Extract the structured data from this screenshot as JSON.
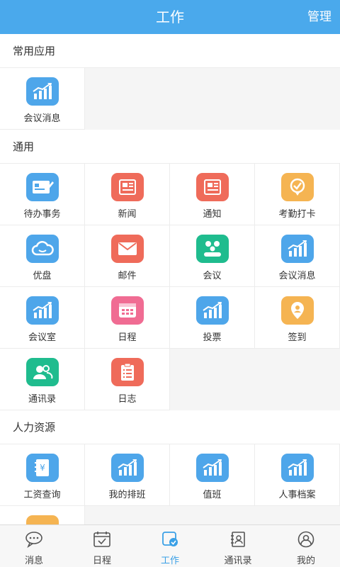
{
  "header": {
    "title": "工作",
    "manage": "管理"
  },
  "sections": [
    {
      "title": "常用应用",
      "items": [
        {
          "label": "会议消息",
          "icon": "bar-chart-icon",
          "color": "#4ea6ea"
        }
      ]
    },
    {
      "title": "通用",
      "items": [
        {
          "label": "待办事务",
          "icon": "todo-card-icon",
          "color": "#4ea6ea"
        },
        {
          "label": "新闻",
          "icon": "newspaper-icon",
          "color": "#ef6b5a"
        },
        {
          "label": "通知",
          "icon": "notice-icon",
          "color": "#ef6b5a"
        },
        {
          "label": "考勤打卡",
          "icon": "checkin-badge-icon",
          "color": "#f5b452"
        },
        {
          "label": "优盘",
          "icon": "cloud-icon",
          "color": "#4ea6ea"
        },
        {
          "label": "邮件",
          "icon": "mail-icon",
          "color": "#ef6b5a"
        },
        {
          "label": "会议",
          "icon": "meeting-people-icon",
          "color": "#1fbc8e"
        },
        {
          "label": "会议消息",
          "icon": "bar-chart-icon",
          "color": "#4ea6ea"
        },
        {
          "label": "会议室",
          "icon": "bar-chart-icon",
          "color": "#4ea6ea"
        },
        {
          "label": "日程",
          "icon": "calendar-grid-icon",
          "color": "#f06c93"
        },
        {
          "label": "投票",
          "icon": "bar-chart-icon",
          "color": "#4ea6ea"
        },
        {
          "label": "签到",
          "icon": "location-pin-icon",
          "color": "#f5b452"
        },
        {
          "label": "通讯录",
          "icon": "contacts-people-icon",
          "color": "#1fbc8e"
        },
        {
          "label": "日志",
          "icon": "clipboard-icon",
          "color": "#ef6b5a"
        }
      ]
    },
    {
      "title": "人力资源",
      "items": [
        {
          "label": "工资查询",
          "icon": "salary-book-icon",
          "color": "#4ea6ea"
        },
        {
          "label": "我的排班",
          "icon": "bar-chart-icon",
          "color": "#4ea6ea"
        },
        {
          "label": "值班",
          "icon": "bar-chart-icon",
          "color": "#4ea6ea"
        },
        {
          "label": "人事档案",
          "icon": "bar-chart-icon",
          "color": "#4ea6ea"
        },
        {
          "label": "",
          "icon": "partial-icon",
          "color": "#f5b452"
        }
      ]
    }
  ],
  "tabs": [
    {
      "label": "消息",
      "icon": "chat-bubble-icon",
      "active": false
    },
    {
      "label": "日程",
      "icon": "calendar-check-icon",
      "active": false
    },
    {
      "label": "工作",
      "icon": "work-check-icon",
      "active": true
    },
    {
      "label": "通讯录",
      "icon": "address-book-icon",
      "active": false
    },
    {
      "label": "我的",
      "icon": "user-circle-icon",
      "active": false
    }
  ]
}
